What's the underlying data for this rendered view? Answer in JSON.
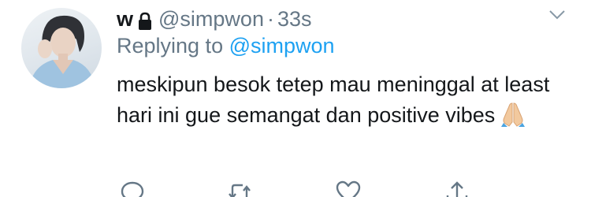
{
  "tweet": {
    "display_name": "w",
    "handle": "@simpwon",
    "separator": "·",
    "time": "33s",
    "replying_prefix": "Replying to ",
    "replying_to": "@simpwon",
    "text": "meskipun besok tetep mau meninggal at least hari ini gue semangat dan positive vibes",
    "emoji": "folded-hands-emoji"
  },
  "icons": {
    "lock": "lock-icon",
    "caret": "chevron-down-icon",
    "reply": "reply-icon",
    "retweet": "retweet-icon",
    "like": "heart-icon",
    "share": "share-icon"
  },
  "colors": {
    "text": "#14171a",
    "secondary": "#657786",
    "accent": "#1da1f2"
  }
}
